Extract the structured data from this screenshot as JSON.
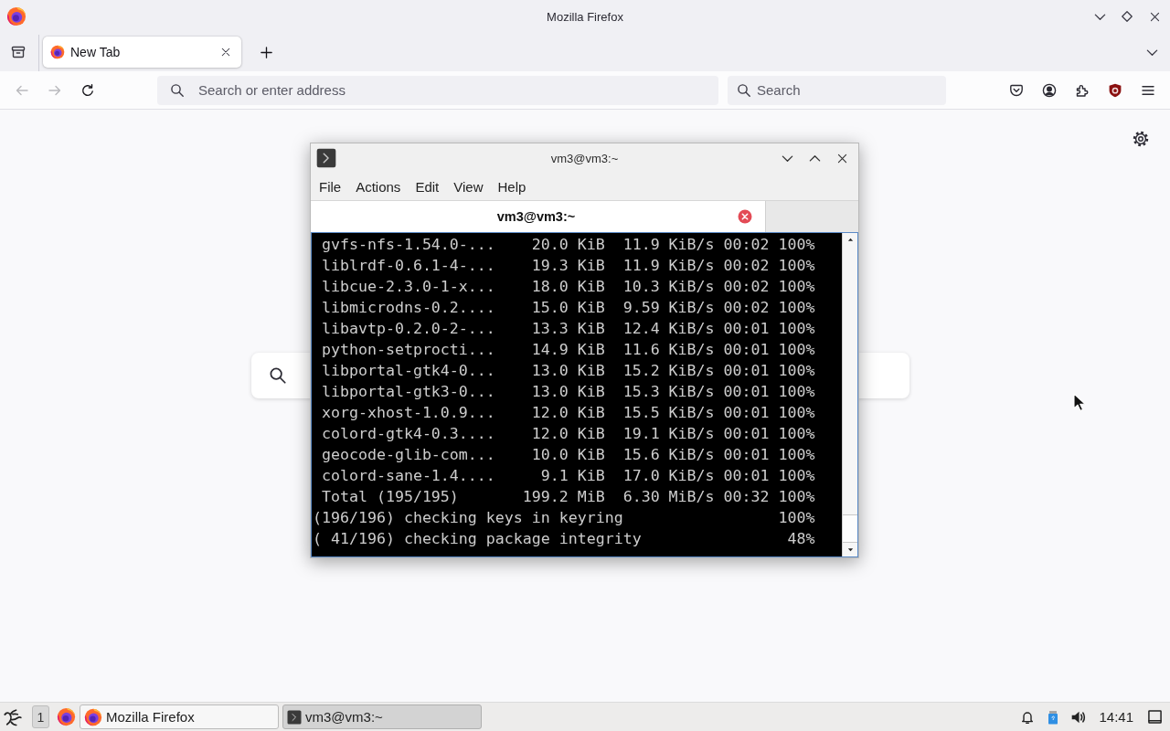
{
  "window": {
    "title": "Mozilla Firefox"
  },
  "tabs": [
    {
      "label": "New Tab",
      "selected": true
    }
  ],
  "toolbar": {
    "nav": [
      {
        "kind": "back",
        "disabled": true
      },
      {
        "kind": "forward",
        "disabled": true
      },
      {
        "kind": "reload",
        "disabled": false
      }
    ],
    "address": {
      "placeholder": "Search or enter address"
    },
    "search": {
      "placeholder": "Search"
    }
  },
  "terminal": {
    "title": "vm3@vm3:~",
    "menu": [
      "File",
      "Actions",
      "Edit",
      "View",
      "Help"
    ],
    "tabs": [
      {
        "label": "vm3@vm3:~",
        "selected": true
      }
    ],
    "lines": [
      " gvfs-nfs-1.54.0-...    20.0 KiB  11.9 KiB/s 00:02 100%",
      " liblrdf-0.6.1-4-...    19.3 KiB  11.9 KiB/s 00:02 100%",
      " libcue-2.3.0-1-x...    18.0 KiB  10.3 KiB/s 00:02 100%",
      " libmicrodns-0.2....    15.0 KiB  9.59 KiB/s 00:02 100%",
      " libavtp-0.2.0-2-...    13.3 KiB  12.4 KiB/s 00:01 100%",
      " python-setprocti...    14.9 KiB  11.6 KiB/s 00:01 100%",
      " libportal-gtk4-0...    13.0 KiB  15.2 KiB/s 00:01 100%",
      " libportal-gtk3-0...    13.0 KiB  15.3 KiB/s 00:01 100%",
      " xorg-xhost-1.0.9...    12.0 KiB  15.5 KiB/s 00:01 100%",
      " colord-gtk4-0.3....    12.0 KiB  19.1 KiB/s 00:01 100%",
      " geocode-glib-com...    10.0 KiB  15.6 KiB/s 00:01 100%",
      " colord-sane-1.4....     9.1 KiB  17.0 KiB/s 00:01 100%",
      " Total (195/195)       199.2 MiB  6.30 MiB/s 00:32 100%",
      "(196/196) checking keys in keyring                 100%",
      "( 41/196) checking package integrity                48%"
    ]
  },
  "taskbar": {
    "workspace": "1",
    "tasks": [
      {
        "kind": "browser",
        "label": "Mozilla Firefox",
        "selected": false
      },
      {
        "kind": "terminal",
        "label": "vm3@vm3:~",
        "selected": true
      }
    ],
    "clock": "14:41"
  }
}
